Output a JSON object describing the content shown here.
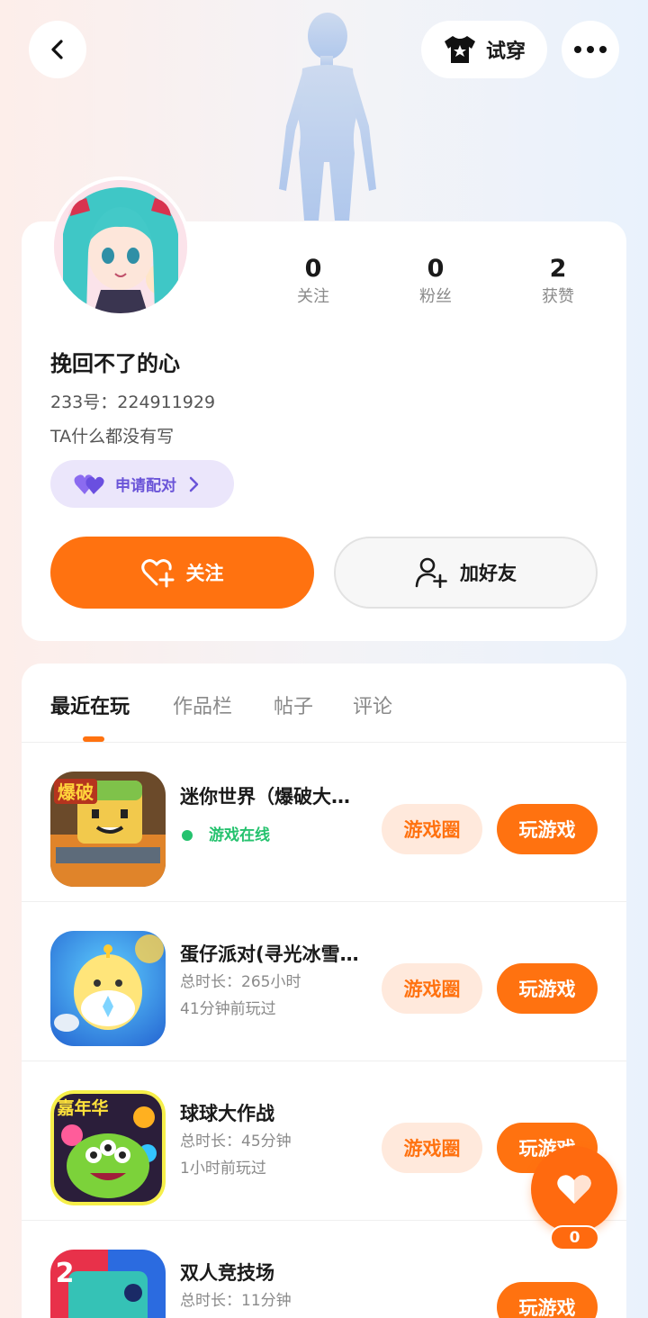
{
  "header": {
    "try_label": "试穿",
    "back_icon": "back-arrow-icon",
    "more_icon": "more-dots-icon"
  },
  "profile": {
    "username": "挽回不了的心",
    "uid": "233号：224911929",
    "bio": "TA什么都没有写",
    "pair_label": "申请配对",
    "stats": [
      {
        "value": "0",
        "label": "关注"
      },
      {
        "value": "0",
        "label": "粉丝"
      },
      {
        "value": "2",
        "label": "获赞"
      }
    ],
    "follow_label": "关注",
    "add_friend_label": "加好友"
  },
  "tabs": [
    {
      "label": "最近在玩",
      "active": true
    },
    {
      "label": "作品栏",
      "active": false
    },
    {
      "label": "帖子",
      "active": false
    },
    {
      "label": "评论",
      "active": false
    }
  ],
  "games": [
    {
      "name": "迷你世界（爆破大…",
      "status": "游戏在线",
      "circle_label": "游戏圈",
      "play_label": "玩游戏"
    },
    {
      "name": "蛋仔派对(寻光冰雪…",
      "duration": "总时长：265小时",
      "last_played": "41分钟前玩过",
      "circle_label": "游戏圈",
      "play_label": "玩游戏"
    },
    {
      "name": "球球大作战",
      "duration": "总时长：45分钟",
      "last_played": "1小时前玩过",
      "circle_label": "游戏圈",
      "play_label": "玩游戏"
    },
    {
      "name": "双人竞技场",
      "duration": "总时长：11分钟",
      "play_label": "玩游戏"
    }
  ],
  "icon_text": {
    "game1": "爆破",
    "game3": "嘉年华",
    "game4": "2"
  },
  "like": {
    "count": "0"
  },
  "colors": {
    "accent": "#ff7210",
    "online": "#25c26e",
    "pair": "#6a54d8"
  }
}
